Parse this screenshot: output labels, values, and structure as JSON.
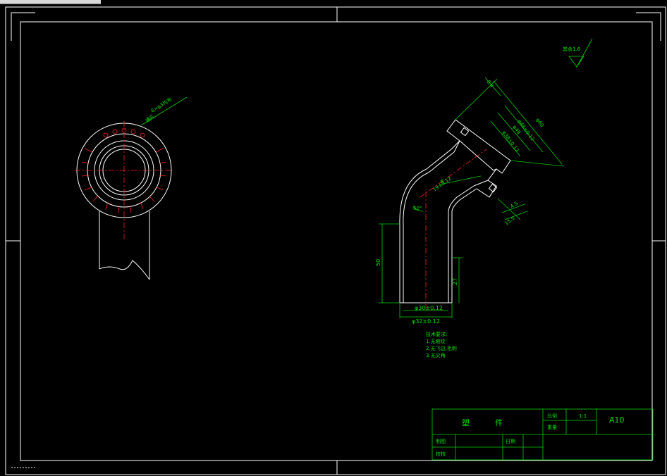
{
  "surface_mark": "其余1.6",
  "hole_callout": "6×φ3均布",
  "hole_note": "通孔",
  "dims": {
    "flange_thk": "0.4",
    "d_outer": "φ60",
    "d_bolt": "φ48",
    "d_inner1": "φ48±0.12",
    "d_inner2": "φ38±0.12",
    "wall": "φ",
    "bore": "19±0.12",
    "angle": "60°",
    "height": "50",
    "lower_len": "27",
    "d_bottom_inner": "φ30±0.12",
    "d_bottom_outer": "φ32±0.12",
    "step1": "4.5",
    "step2": "15.5"
  },
  "tech_req": {
    "title": "技术要求:",
    "items": [
      "1.无缩纹",
      "2.无飞边,毛刺",
      "3.无尖角"
    ]
  },
  "title_block": {
    "part_name_1": "塑",
    "part_name_2": "件",
    "scale_label": "比例",
    "scale_value": "1:1",
    "weight_label": "重量",
    "drawing_no": "A10",
    "drawn_label": "制图",
    "checked_label": "校核",
    "date_label": "日期"
  }
}
